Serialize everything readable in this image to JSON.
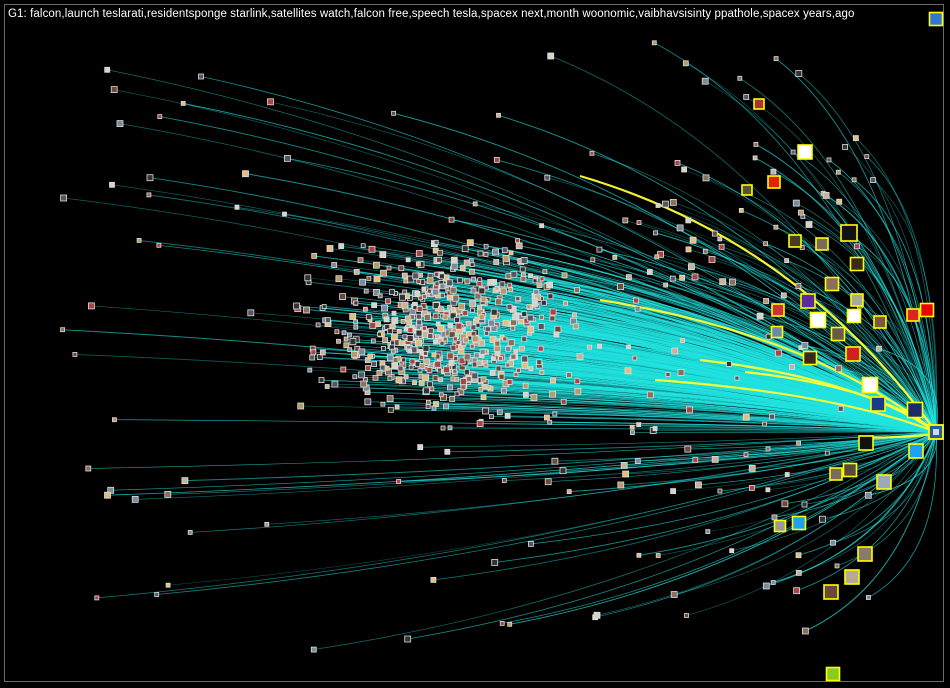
{
  "group": {
    "label": "G1: falcon,launch  teslarati,residentsponge  starlink,satellites  watch,falcon  free,speech  tesla,spacex  next,month  woonomic,vaibhavsisinty  ppathole,spacex  years,ago"
  },
  "colors": {
    "background": "#000000",
    "edge": "#22e3e0",
    "highlight_edge": "#ffff33",
    "node_border": "#dddddd",
    "hub_border": "#ffff00"
  },
  "icons": {
    "hub": "spacex-avatar-icon",
    "logos": [
      "apple-logo-icon",
      "forbes-logo-icon",
      "techcrunch-logo-icon",
      "google-logo-icon",
      "nasa-logo-icon",
      "twitter-logo-icon",
      "youtube-logo-icon",
      "x-logo-icon",
      "tesla-logo-icon",
      "mcdonalds-logo-icon",
      "wsj-logo-icon"
    ]
  }
}
